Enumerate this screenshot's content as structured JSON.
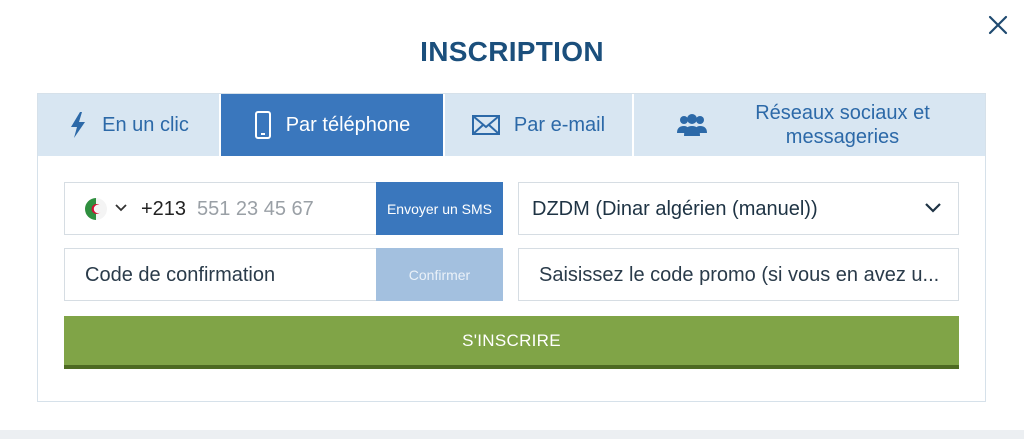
{
  "modal": {
    "title": "INSCRIPTION"
  },
  "tabs": [
    {
      "label": "En un clic",
      "icon": "lightning-icon"
    },
    {
      "label": "Par téléphone",
      "icon": "smartphone-icon",
      "active": true
    },
    {
      "label": "Par e-mail",
      "icon": "envelope-icon"
    },
    {
      "label": "Réseaux sociaux et messageries",
      "icon": "users-icon"
    }
  ],
  "form": {
    "phone": {
      "prefix": "+213",
      "placeholder": "551 23 45 67",
      "flag": "algeria-flag-icon"
    },
    "send_sms_label": "Envoyer un SMS",
    "currency": {
      "value": "DZDM (Dinar algérien (manuel))"
    },
    "code": {
      "placeholder": "Code de confirmation"
    },
    "confirm_label": "Confirmer",
    "promo": {
      "placeholder": "Saisissez le code promo (si vous en avez u..."
    },
    "submit_label": "S'INSCRIRE"
  },
  "colors": {
    "title": "#1b4f7c",
    "tab_active": "#3a77bd",
    "tab_inactive": "#d8e6f2",
    "submit": "#80a447",
    "confirm_disabled": "#a3c0df"
  }
}
